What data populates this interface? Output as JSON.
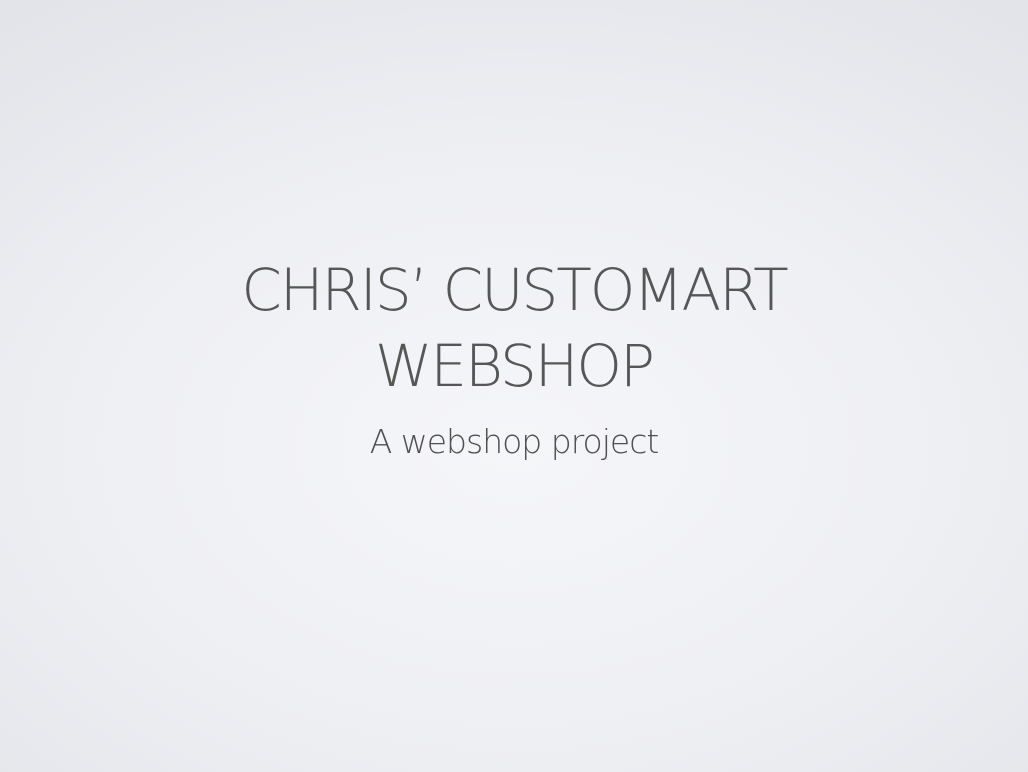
{
  "slide": {
    "title_lines": [
      "CHRIS’ CUSTOMART",
      "WEBSHOP"
    ],
    "subtitle": "A webshop project"
  },
  "colors": {
    "background_center": "#f5f6f9",
    "background_edge": "#dcdfe4",
    "text": "#565656"
  }
}
